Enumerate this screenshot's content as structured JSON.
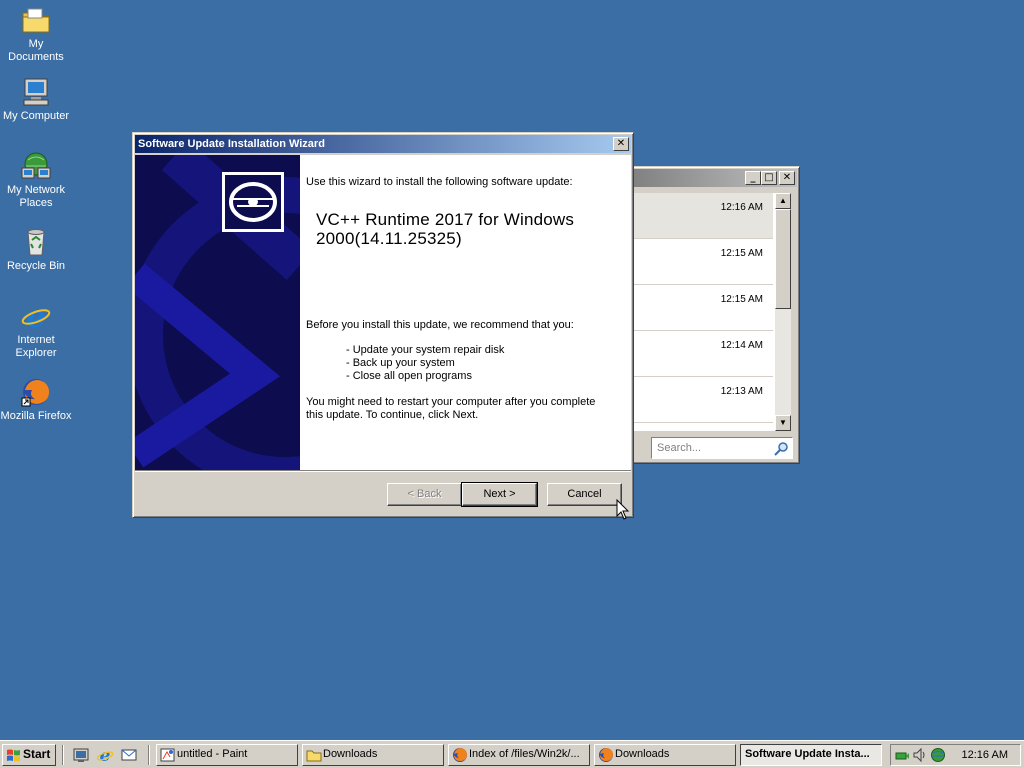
{
  "desktop": {
    "icons": [
      {
        "label": "My Documents",
        "icon": "folder-icon"
      },
      {
        "label": "My Computer",
        "icon": "computer-icon"
      },
      {
        "label": "My Network Places",
        "icon": "network-icon"
      },
      {
        "label": "Recycle Bin",
        "icon": "recycle-bin-icon"
      },
      {
        "label": "Internet Explorer",
        "icon": "ie-icon"
      },
      {
        "label": "Mozilla Firefox",
        "icon": "firefox-icon"
      }
    ]
  },
  "downloads_window": {
    "rows": [
      {
        "time": "12:16 AM"
      },
      {
        "time": "12:15 AM"
      },
      {
        "time": "12:15 AM"
      },
      {
        "time": "12:14 AM"
      },
      {
        "time": "12:13 AM"
      }
    ],
    "search_placeholder": "Search..."
  },
  "wizard": {
    "title": "Software Update Installation Wizard",
    "intro": "Use this wizard to install the following software update:",
    "product_name": "VC++ Runtime 2017 for Windows 2000(14.11.25325)",
    "recommend": "Before you install this update, we recommend that you:",
    "bullets": [
      "- Update your system repair disk",
      "- Back up your system",
      "- Close all open programs"
    ],
    "restart_note": "You might need to restart your computer after you complete this update. To continue, click Next.",
    "buttons": {
      "back": "< Back",
      "next": "Next >",
      "cancel": "Cancel"
    },
    "colors": {
      "banner": "#0c0c4e",
      "title_start": "#0a246a",
      "title_end": "#a6caf0"
    }
  },
  "taskbar": {
    "start_label": "Start",
    "tasks": [
      {
        "label": "untitled - Paint",
        "icon": "paint-icon"
      },
      {
        "label": "Downloads",
        "icon": "folder-icon"
      },
      {
        "label": "Index of /files/Win2k/...",
        "icon": "firefox-icon"
      },
      {
        "label": "Downloads",
        "icon": "firefox-icon"
      },
      {
        "label": "Software Update Insta...",
        "icon": ""
      }
    ],
    "clock": "12:16 AM"
  },
  "colors": {
    "desktop": "#3a6ea5",
    "face": "#d4d0c8"
  }
}
